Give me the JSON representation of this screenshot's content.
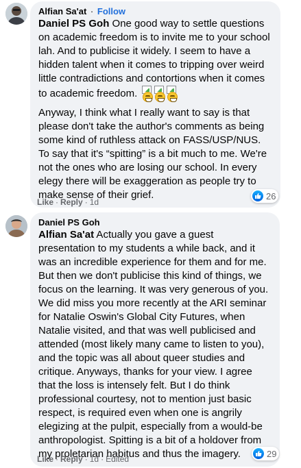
{
  "comments": [
    {
      "author": "Alfian Sa'at",
      "follow_sep": "·",
      "follow": "Follow",
      "mention": "Daniel PS Goh",
      "para1": " One good way to settle questions on academic freedom is to invite me to your school lah. And to publicise it widely. I seem to have a hidden talent when it comes to tripping over weird little contradictions and contortions when it comes to academic freedom.",
      "emoji_icon": "grinning-face-emoji",
      "para2": "Anyway, I think what I really want to say is that please don't take the author's comments as being some kind of ruthless attack on FASS/USP/NUS. To say that it's “spitting” is a bit much to me. We're not the ones who are losing our school. In every elegy there will be exaggeration as people try to make sense of their grief.",
      "like": "Like",
      "reply": "Reply",
      "sep": "·",
      "time": "1d",
      "reaction_count": "26"
    },
    {
      "author": "Daniel PS Goh",
      "mention": "Alfian Sa'at",
      "para1": " Actually you gave a guest presentation to my students a while back, and it was an incredible experience for them and for me. But then we don't publicise this kind of things, we focus on the learning. It was very generous of you. We did miss you more recently at the ARI seminar for Natalie Oswin's Global City Futures, when Natalie visited, and that was well publicised and attended (most likely many came to listen to you), and the topic was all about queer studies and critique. Anyways, thanks for your view. I agree that the loss is intensely felt. But I do think professional courtesy, not to mention just basic respect, is required even when one is angrily elegizing at the pulpit, especially from a would-be anthropologist. Spitting is a bit of a holdover from my proletarian habitus and thus the imagery.",
      "like": "Like",
      "reply": "Reply",
      "sep": "·",
      "time": "1d",
      "edited": "Edited",
      "reaction_count": "29"
    }
  ],
  "colors": {
    "bubble": "#f0f2f5",
    "link": "#216fdb",
    "meta": "#65676b",
    "like_blue": "#0062df"
  }
}
